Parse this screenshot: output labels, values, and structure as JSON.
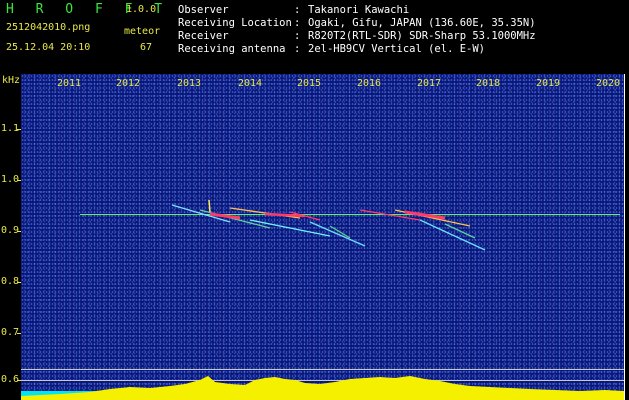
{
  "header": {
    "logo": "H R O F F T",
    "version": "1.0.0",
    "filename": "2512042010.png",
    "mode_label": "meteor",
    "datetime": "25.12.04 20:10",
    "count": "67",
    "info": [
      {
        "label": "Observer",
        "value": "Takanori Kawachi"
      },
      {
        "label": "Receiving Location",
        "value": "Ogaki, Gifu, JAPAN (136.60E, 35.35N)"
      },
      {
        "label": "Receiver",
        "value": "R820T2(RTL-SDR) SDR-Sharp 53.1000MHz"
      },
      {
        "label": "Receiving antenna",
        "value": "2el-HB9CV Vertical (el. E-W)"
      }
    ],
    "separator": ":"
  },
  "axis": {
    "unit": "kHz",
    "y_labels": [
      "1.1",
      "1.0",
      "0.9",
      "0.8",
      "0.7",
      "0.6"
    ],
    "x_labels": [
      "2011",
      "2012",
      "2013",
      "2014",
      "2015",
      "2016",
      "2017",
      "2018",
      "2019",
      "2020"
    ]
  },
  "colors": {
    "background": "#000000",
    "spectrum_bg": "#0b167a",
    "label_yellow": "#e8e84a",
    "logo_green": "#39e63a",
    "carrier_green": "#5ef06a",
    "meteor_red": "#ff3a6a",
    "power_yellow": "#f5f000",
    "power_cyan": "#00e6f0"
  }
}
